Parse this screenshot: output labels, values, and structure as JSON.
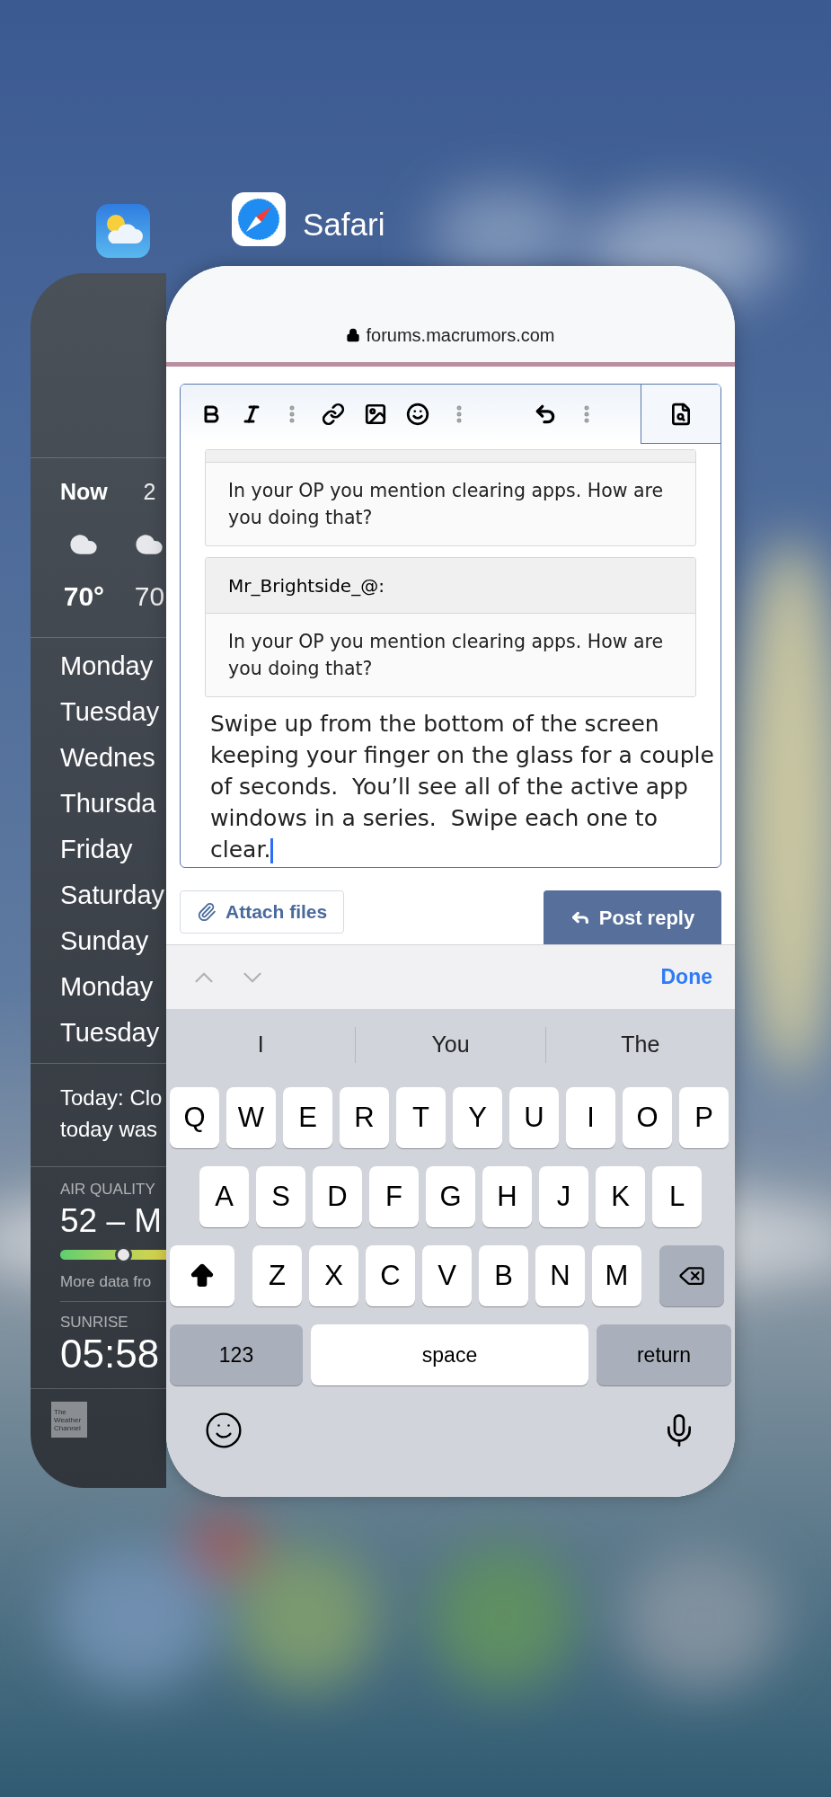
{
  "weather": {
    "hourly": [
      {
        "time": "Now",
        "temp": "70°"
      },
      {
        "time": "2",
        "temp": "70"
      }
    ],
    "days": [
      "Monday",
      "Tuesday",
      "Wednes",
      "Thursda",
      "Friday",
      "Saturday",
      "Sunday",
      "Monday",
      "Tuesday"
    ],
    "summary": [
      "Today: Clo",
      "today was"
    ],
    "air_quality": {
      "label": "AIR QUALITY",
      "value": "52 – M",
      "level": 0.27,
      "note": "More data fro"
    },
    "sunrise": {
      "label": "SUNRISE",
      "value": "05:58"
    },
    "logo": [
      "The",
      "Weather",
      "Channel"
    ]
  },
  "safari": {
    "app_label": "Safari",
    "url": "forums.macrumors.com",
    "quotes": [
      {
        "kind": "cut",
        "body": "In your OP you mention clearing apps. How are you doing that?"
      },
      {
        "kind": "full",
        "author": "Mr_Brightside_@:",
        "body": "In your OP you mention clearing apps. How are you doing that?"
      }
    ],
    "reply_text": "Swipe up from the bottom of the screen keeping your finger on the glass for a couple of seconds.  You’ll see all of the active app windows in a series.  Swipe each one to clear.",
    "attach_label": "Attach files",
    "post_label": "Post reply",
    "done_label": "Done",
    "suggestions": [
      "I",
      "You",
      "The"
    ],
    "keys": [
      [
        "Q",
        "W",
        "E",
        "R",
        "T",
        "Y",
        "U",
        "I",
        "O",
        "P"
      ],
      [
        "A",
        "S",
        "D",
        "F",
        "G",
        "H",
        "J",
        "K",
        "L"
      ],
      [
        "Z",
        "X",
        "C",
        "V",
        "B",
        "N",
        "M"
      ]
    ],
    "numbers_key": "123",
    "space_key": "space",
    "return_key": "return"
  }
}
